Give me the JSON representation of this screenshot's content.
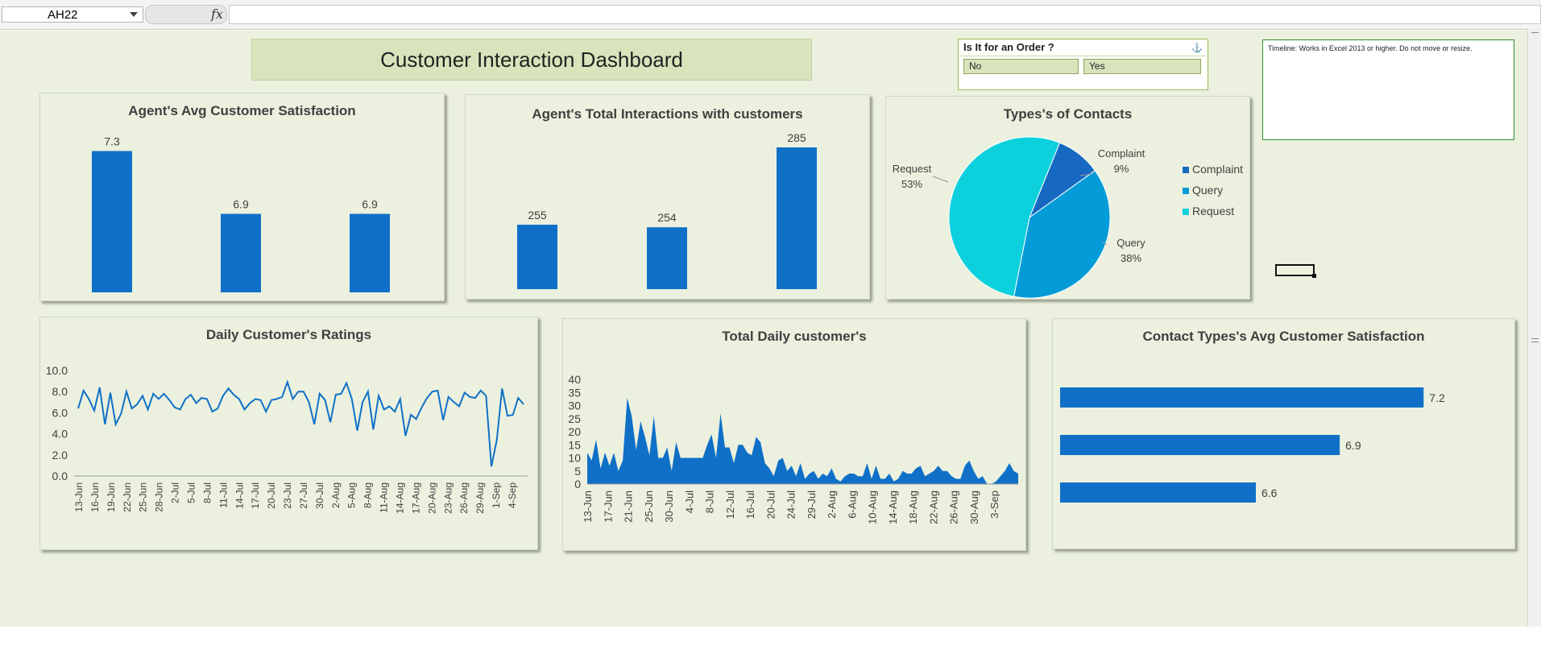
{
  "formula_bar": {
    "name_box": "AH22",
    "fx_symbol": "fx",
    "formula_value": ""
  },
  "dashboard_title": "Customer Interaction Dashboard",
  "slicer": {
    "title": "Is It for an Order ?",
    "items": [
      "No",
      "Yes"
    ]
  },
  "timeline": {
    "text": "Timeline: Works in Excel 2013 or higher. Do not move or resize."
  },
  "colors": {
    "bar": "#1070c8",
    "pie_complaint": "#1668c0",
    "pie_query": "#039cd8",
    "pie_request": "#0cd0dc",
    "sheet_bg": "#ebf1de"
  },
  "chart_data": [
    {
      "type": "bar",
      "title": "Agent's Avg Customer Satisfaction",
      "categories": [
        "",
        "",
        ""
      ],
      "values": [
        7.3,
        6.9,
        6.9
      ],
      "data_labels": [
        "7.3",
        "6.9",
        "6.9"
      ],
      "ylim": [
        6.4,
        7.4
      ]
    },
    {
      "type": "bar",
      "title": "Agent's Total  Interactions with customers",
      "categories": [
        "",
        "",
        ""
      ],
      "values": [
        255,
        254,
        285
      ],
      "data_labels": [
        "255",
        "254",
        "285"
      ],
      "ylim": [
        230,
        290
      ]
    },
    {
      "type": "pie",
      "title": "Types's of Contacts",
      "categories": [
        "Complaint",
        "Query",
        "Request"
      ],
      "values": [
        9,
        38,
        53
      ],
      "data_labels": [
        {
          "name": "Complaint",
          "pct": "9%"
        },
        {
          "name": "Query",
          "pct": "38%"
        },
        {
          "name": "Request",
          "pct": "53%"
        }
      ],
      "legend": [
        "Complaint",
        "Query",
        "Request"
      ],
      "legend_position": "right"
    },
    {
      "type": "line",
      "title": "Daily Customer's Ratings",
      "ylim": [
        0,
        10
      ],
      "y_ticks": [
        "0.0",
        "2.0",
        "4.0",
        "6.0",
        "8.0",
        "10.0"
      ],
      "x_labels": [
        "13-Jun",
        "16-Jun",
        "19-Jun",
        "22-Jun",
        "25-Jun",
        "28-Jun",
        "2-Jul",
        "5-Jul",
        "8-Jul",
        "11-Jul",
        "14-Jul",
        "17-Jul",
        "20-Jul",
        "23-Jul",
        "27-Jul",
        "30-Jul",
        "2-Aug",
        "5-Aug",
        "8-Aug",
        "11-Aug",
        "14-Aug",
        "17-Aug",
        "20-Aug",
        "23-Aug",
        "26-Aug",
        "29-Aug",
        "1-Sep",
        "4-Sep"
      ],
      "values": [
        6.4,
        8.1,
        7.3,
        6.2,
        8.4,
        4.9,
        7.9,
        4.9,
        5.9,
        8.0,
        6.4,
        6.8,
        7.6,
        6.3,
        7.8,
        7.3,
        7.8,
        7.2,
        6.5,
        6.3,
        7.3,
        7.7,
        6.9,
        7.4,
        7.3,
        6.1,
        6.4,
        7.6,
        8.3,
        7.7,
        7.3,
        6.3,
        6.9,
        7.3,
        7.2,
        6.1,
        7.2,
        7.3,
        7.5,
        8.9,
        7.3,
        8.0,
        8.0,
        7.0,
        4.9,
        7.8,
        7.2,
        5.1,
        7.7,
        7.8,
        8.8,
        7.3,
        4.3,
        7.0,
        8.0,
        4.4,
        7.6,
        6.3,
        6.6,
        6.1,
        7.3,
        3.8,
        5.8,
        5.4,
        6.5,
        7.4,
        8.0,
        8.1,
        5.3,
        7.5,
        7.0,
        6.6,
        7.9,
        7.5,
        7.4,
        8.1,
        7.6,
        0.9,
        3.4,
        8.3,
        5.7,
        5.8,
        7.4,
        6.8
      ]
    },
    {
      "type": "area",
      "title": "Total Daily customer's",
      "ylim": [
        0,
        40
      ],
      "y_ticks": [
        "0",
        "5",
        "10",
        "15",
        "20",
        "25",
        "30",
        "35",
        "40"
      ],
      "x_labels": [
        "13-Jun",
        "17-Jun",
        "21-Jun",
        "25-Jun",
        "30-Jun",
        "4-Jul",
        "8-Jul",
        "12-Jul",
        "16-Jul",
        "20-Jul",
        "24-Jul",
        "29-Jul",
        "2-Aug",
        "6-Aug",
        "10-Aug",
        "14-Aug",
        "18-Aug",
        "22-Aug",
        "26-Aug",
        "30-Aug",
        "3-Sep"
      ],
      "values": [
        12,
        9,
        17,
        6,
        12,
        7,
        12,
        5,
        9,
        33,
        26,
        13,
        24,
        18,
        11,
        26,
        10,
        10,
        14,
        5,
        16,
        10,
        10,
        10,
        10,
        10,
        10,
        15,
        19,
        10,
        27,
        14,
        14,
        8,
        15,
        15,
        12,
        11,
        18,
        16,
        8,
        6,
        3,
        9,
        10,
        5,
        7,
        3,
        8,
        2,
        4,
        5,
        2,
        4,
        3,
        6,
        2,
        1,
        3,
        4,
        4,
        3,
        3,
        8,
        2,
        7,
        2,
        2,
        4,
        1,
        2,
        5,
        4,
        4,
        6,
        7,
        3,
        4,
        5,
        7,
        5,
        5,
        3,
        2,
        2,
        7,
        9,
        5,
        2,
        3,
        0,
        0,
        1,
        3,
        5,
        8,
        5,
        4
      ]
    },
    {
      "type": "bar",
      "orientation": "horizontal",
      "title": "Contact Types's Avg Customer Satisfaction",
      "categories": [
        "",
        "",
        ""
      ],
      "values": [
        7.2,
        6.9,
        6.6
      ],
      "data_labels": [
        "7.2",
        "6.9",
        "6.6"
      ],
      "xlim": [
        5.9,
        7.3
      ]
    }
  ]
}
